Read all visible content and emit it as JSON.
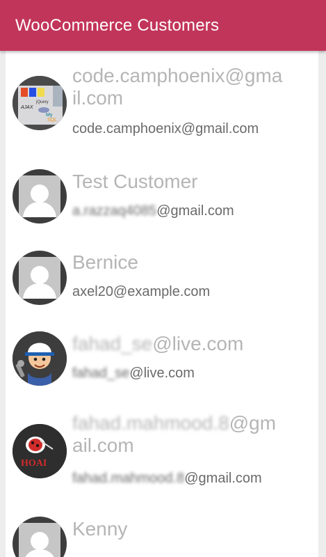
{
  "appbar": {
    "title": "WooCommerce Customers"
  },
  "customers": [
    {
      "name_lines": [
        "code.camphoenix@gma",
        "il.com"
      ],
      "email": "code.camphoenix@gmail.com",
      "avatar": "tech-logos-collage"
    },
    {
      "name_lines": [
        "Test Customer"
      ],
      "email_blurred": "a.razzaq4085",
      "email_visible": "@gmail.com",
      "avatar": "default-user-silhouette"
    },
    {
      "name_lines": [
        "Bernice"
      ],
      "email": "axel20@example.com",
      "avatar": "default-user-silhouette"
    },
    {
      "name_blurred": "fahad_se",
      "name_visible": "@live.com",
      "email_blurred": "fahad_se",
      "email_visible": "@live.com",
      "avatar": "cartoon-mechanic"
    },
    {
      "name_blurred": "fahad.mahmood.8",
      "name_visible": "@gm",
      "name_line2": "ail.com",
      "email_blurred": "fahad.mahmood.8",
      "email_visible": "@gmail.com",
      "avatar": "ladybug-logo"
    },
    {
      "name_lines": [
        "Kenny"
      ],
      "avatar": "default-user-silhouette"
    }
  ],
  "colors": {
    "appbar": "#c2355a",
    "name_text": "#b5b5b5",
    "email_text": "#6a6a6a",
    "avatar_ring": "#3d3d3d"
  }
}
